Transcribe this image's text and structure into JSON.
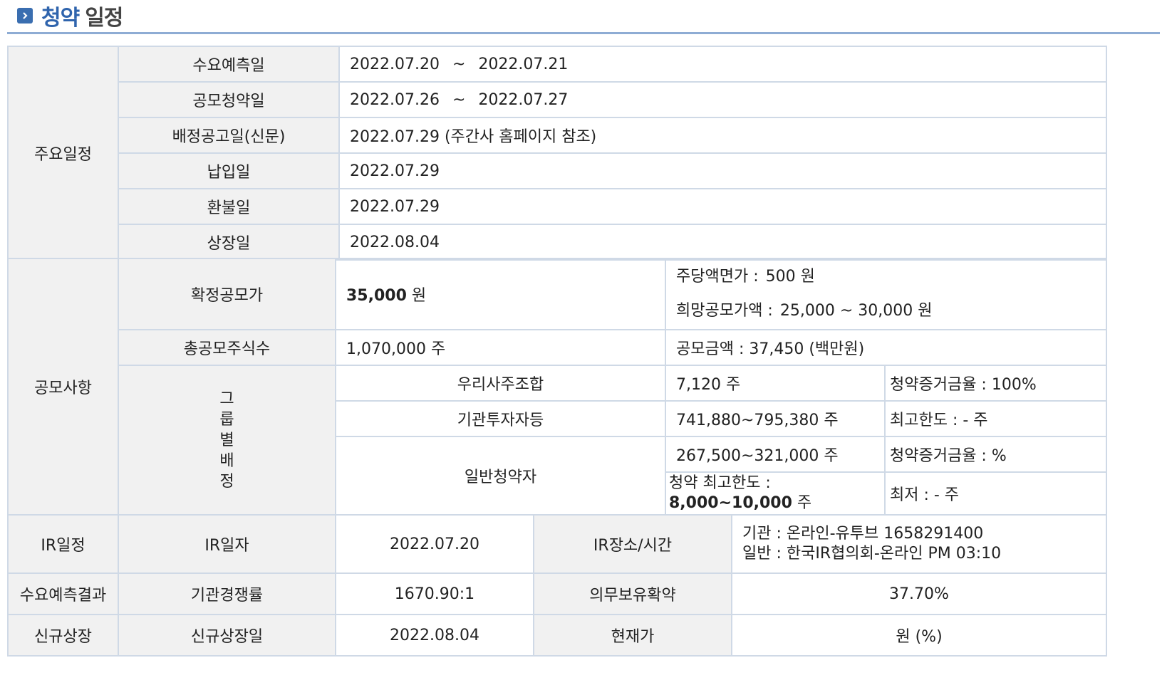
{
  "header": {
    "title_part1": "청약",
    "title_part2": "일정"
  },
  "schedule": {
    "section_label": "주요일정",
    "demand_forecast": {
      "label": "수요예측일",
      "start": "2022.07.20",
      "sep": "~",
      "end": "2022.07.21"
    },
    "subscription": {
      "label": "공모청약일",
      "start": "2022.07.26",
      "sep": "~",
      "end": "2022.07.27"
    },
    "allotment_notice": {
      "label": "배정공고일(신문)",
      "value": "2022.07.29 (주간사 홈페이지 참조)"
    },
    "payment": {
      "label": "납입일",
      "value": "2022.07.29"
    },
    "refund": {
      "label": "환불일",
      "value": "2022.07.29"
    },
    "listing": {
      "label": "상장일",
      "value": "2022.08.04"
    }
  },
  "offering": {
    "section_label": "공모사항",
    "final_price": {
      "label": "확정공모가",
      "value": "35,000",
      "unit": "원"
    },
    "par_value": {
      "label": "주당액면가 :",
      "value": "500 원"
    },
    "desired_price": {
      "label": "희망공모가액 :",
      "value": "25,000 ~ 30,000 원"
    },
    "total_shares": {
      "label": "총공모주식수",
      "value": "1,070,000 주"
    },
    "offering_amount": {
      "text": "공모금액 : 37,450 (백만원)"
    },
    "group_label_chars": [
      "그",
      "룹",
      "별",
      "배",
      "정"
    ],
    "groups": {
      "esop": {
        "name": "우리사주조합",
        "shares": "7,120 주",
        "note": "청약증거금율 : 100%"
      },
      "institutional": {
        "name": "기관투자자등",
        "shares": "741,880~795,380 주",
        "note": "최고한도 :  - 주"
      },
      "retail": {
        "name": "일반청약자",
        "shares": "267,500~321,000 주",
        "note": "청약증거금율 : %",
        "max_label": "청약 최고한도 :",
        "max_value": "8,000~10,000",
        "max_unit": "주",
        "min_note": "최저 :  - 주"
      }
    }
  },
  "ir": {
    "section_label": "IR일정",
    "date_label": "IR일자",
    "date_value": "2022.07.20",
    "place_label": "IR장소/시간",
    "place_line1": "기관 : 온라인-유투브 1658291400",
    "place_line2": "일반 : 한국IR협의회-온라인 PM 03:10"
  },
  "demand_result": {
    "section_label": "수요예측결과",
    "competition_label": "기관경쟁률",
    "competition_value": "1670.90:1",
    "lockup_label": "의무보유확약",
    "lockup_value": "37.70%"
  },
  "new_listing": {
    "section_label": "신규상장",
    "date_label": "신규상장일",
    "date_value": "2022.08.04",
    "price_label": "현재가",
    "price_value": "원 (%)"
  }
}
